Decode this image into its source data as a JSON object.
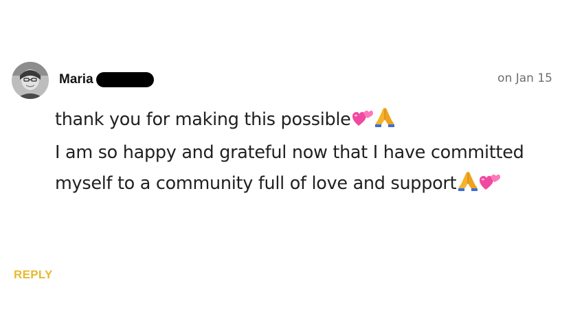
{
  "comment": {
    "author_first_name": "Maria",
    "date": "on Jan 15",
    "lines": [
      "thank you for making this possible",
      "I am so happy and grateful now that I have committed",
      "myself to a community full of love and support"
    ],
    "icons": {
      "line1": [
        "two-hearts-icon",
        "folded-hands-icon"
      ],
      "line3": [
        "folded-hands-icon",
        "two-hearts-icon"
      ]
    },
    "reply_label": "REPLY"
  },
  "colors": {
    "reply": "#e8b92c",
    "date": "#6e6e6e",
    "text": "#1f1f1f"
  }
}
